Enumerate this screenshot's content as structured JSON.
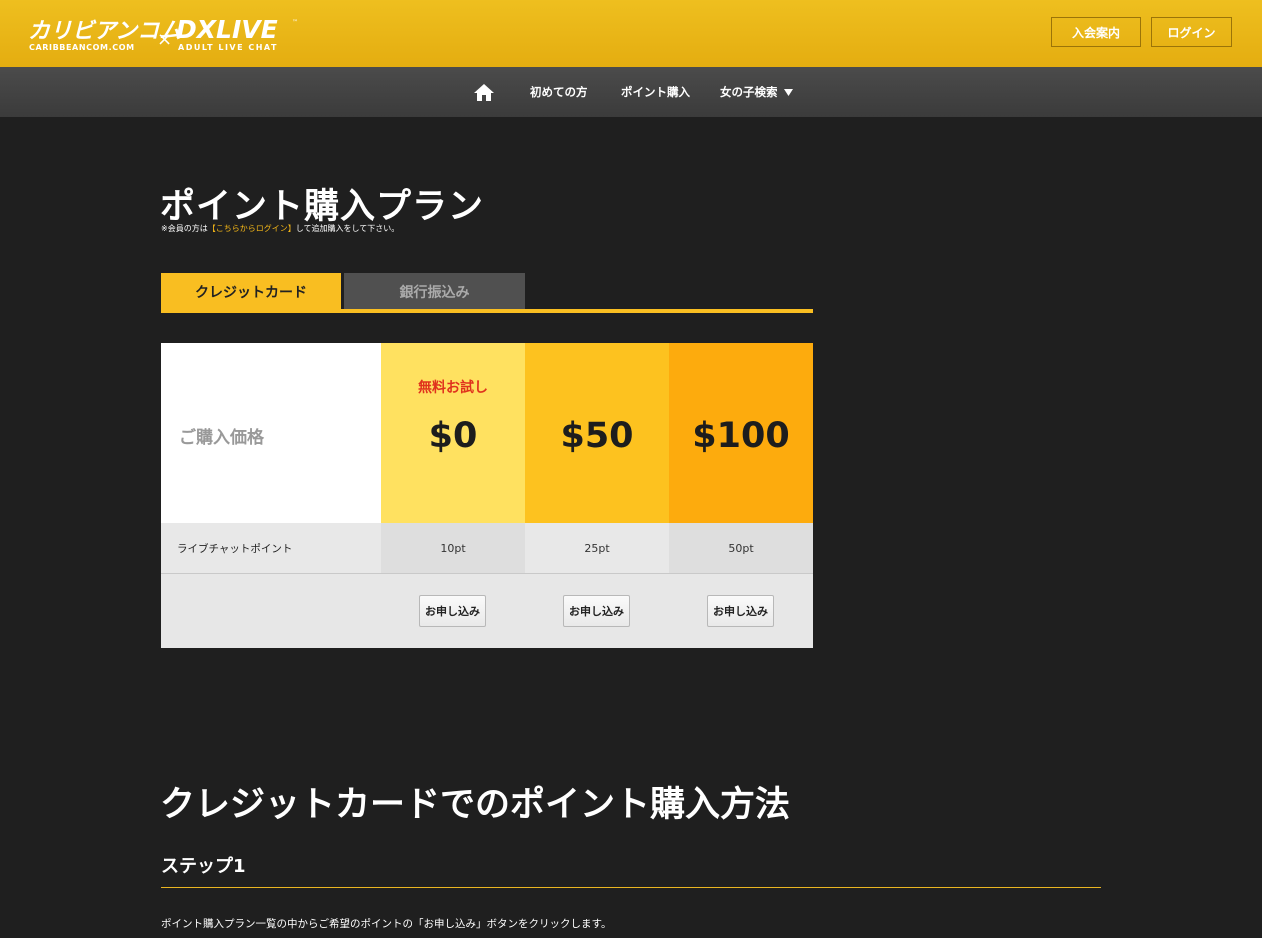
{
  "header": {
    "logo_primary": "カリビアンコム",
    "logo_primary_sub": "CARIBBEANCOM.COM",
    "logo_cross": "×",
    "logo_secondary": "DXLIVE",
    "logo_tm": "™",
    "logo_secondary_sub": "ADULT LIVE CHAT",
    "join_label": "入会案内",
    "login_label": "ログイン"
  },
  "nav": {
    "home_icon": "home-icon",
    "items": [
      "初めての方",
      "ポイント購入",
      "女の子検索"
    ],
    "dropdown_caret": "▼"
  },
  "page": {
    "title": "ポイント購入プラン",
    "note_prefix": "※会員の方は",
    "note_link": "【こちらからログイン】",
    "note_suffix": "して追加購入をして下さい。"
  },
  "tabs": [
    {
      "label": "クレジットカード",
      "active": true
    },
    {
      "label": "銀行振込み",
      "active": false
    }
  ],
  "price_table": {
    "price_row_label": "ご購入価格",
    "points_row_label": "ライブチャットポイント",
    "plans": [
      {
        "badge": "無料お試し",
        "price": "$0",
        "points": "10pt",
        "button": "お申し込み",
        "color": "#ffe160"
      },
      {
        "badge": "",
        "price": "$50",
        "points": "25pt",
        "button": "お申し込み",
        "color": "#fdc21f"
      },
      {
        "badge": "",
        "price": "$100",
        "points": "50pt",
        "button": "お申し込み",
        "color": "#fdab0d"
      }
    ]
  },
  "method": {
    "heading": "クレジットカードでのポイント購入方法",
    "step_title": "ステップ1",
    "step_desc": "ポイント購入プラン一覧の中からご希望のポイントの「お申し込み」ボタンをクリックします。"
  },
  "colors": {
    "header_bg": "#e4ad10",
    "accent": "#f9be21",
    "page_bg": "#1f1f1f",
    "free_label": "#e0331d"
  }
}
